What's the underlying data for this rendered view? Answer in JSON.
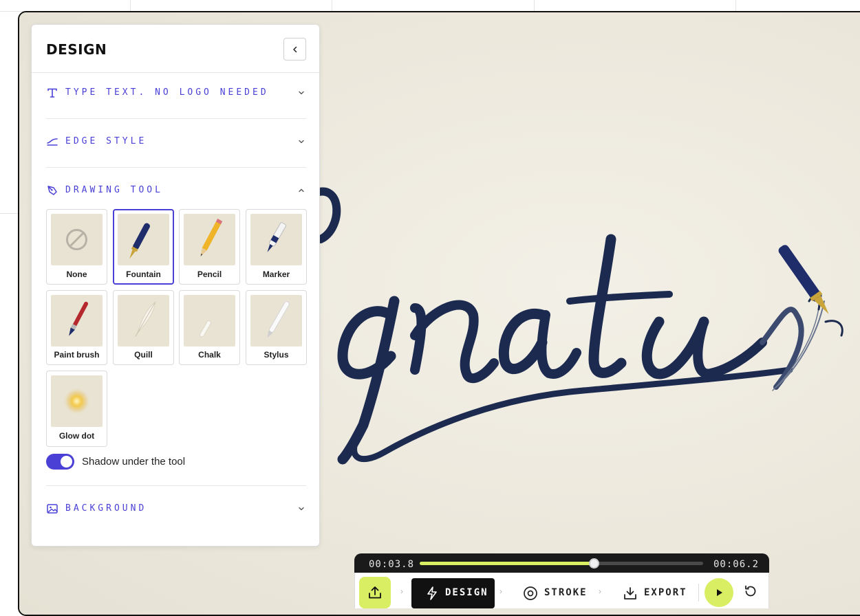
{
  "panel": {
    "title": "DESIGN",
    "sections": {
      "type_text": {
        "label": "TYPE TEXT. NO LOGO NEEDED",
        "icon": "text-type-icon"
      },
      "edge_style": {
        "label": "EDGE STYLE",
        "icon": "edge-curve-icon"
      },
      "drawing_tool": {
        "label": "DRAWING TOOL",
        "icon": "pen-tool-icon"
      },
      "background": {
        "label": "BACKGROUND",
        "icon": "image-icon"
      }
    },
    "tools": [
      {
        "name": "None",
        "selected": false
      },
      {
        "name": "Fountain",
        "selected": true
      },
      {
        "name": "Pencil",
        "selected": false
      },
      {
        "name": "Marker",
        "selected": false
      },
      {
        "name": "Paint brush",
        "selected": false
      },
      {
        "name": "Quill",
        "selected": false
      },
      {
        "name": "Chalk",
        "selected": false
      },
      {
        "name": "Stylus",
        "selected": false
      },
      {
        "name": "Glow dot",
        "selected": false
      }
    ],
    "shadow_toggle": {
      "label": "Shadow under the tool",
      "on": true
    }
  },
  "player": {
    "time_current": "00:03.8",
    "time_total": "00:06.2",
    "progress": 0.613,
    "steps": {
      "design": "DESIGN",
      "stroke": "STROKE",
      "export": "EXPORT"
    }
  },
  "colors": {
    "accent": "#4a40d6",
    "lime": "#d9ee63",
    "ink": "#1b2a4e",
    "paper": "#ece8dc"
  }
}
